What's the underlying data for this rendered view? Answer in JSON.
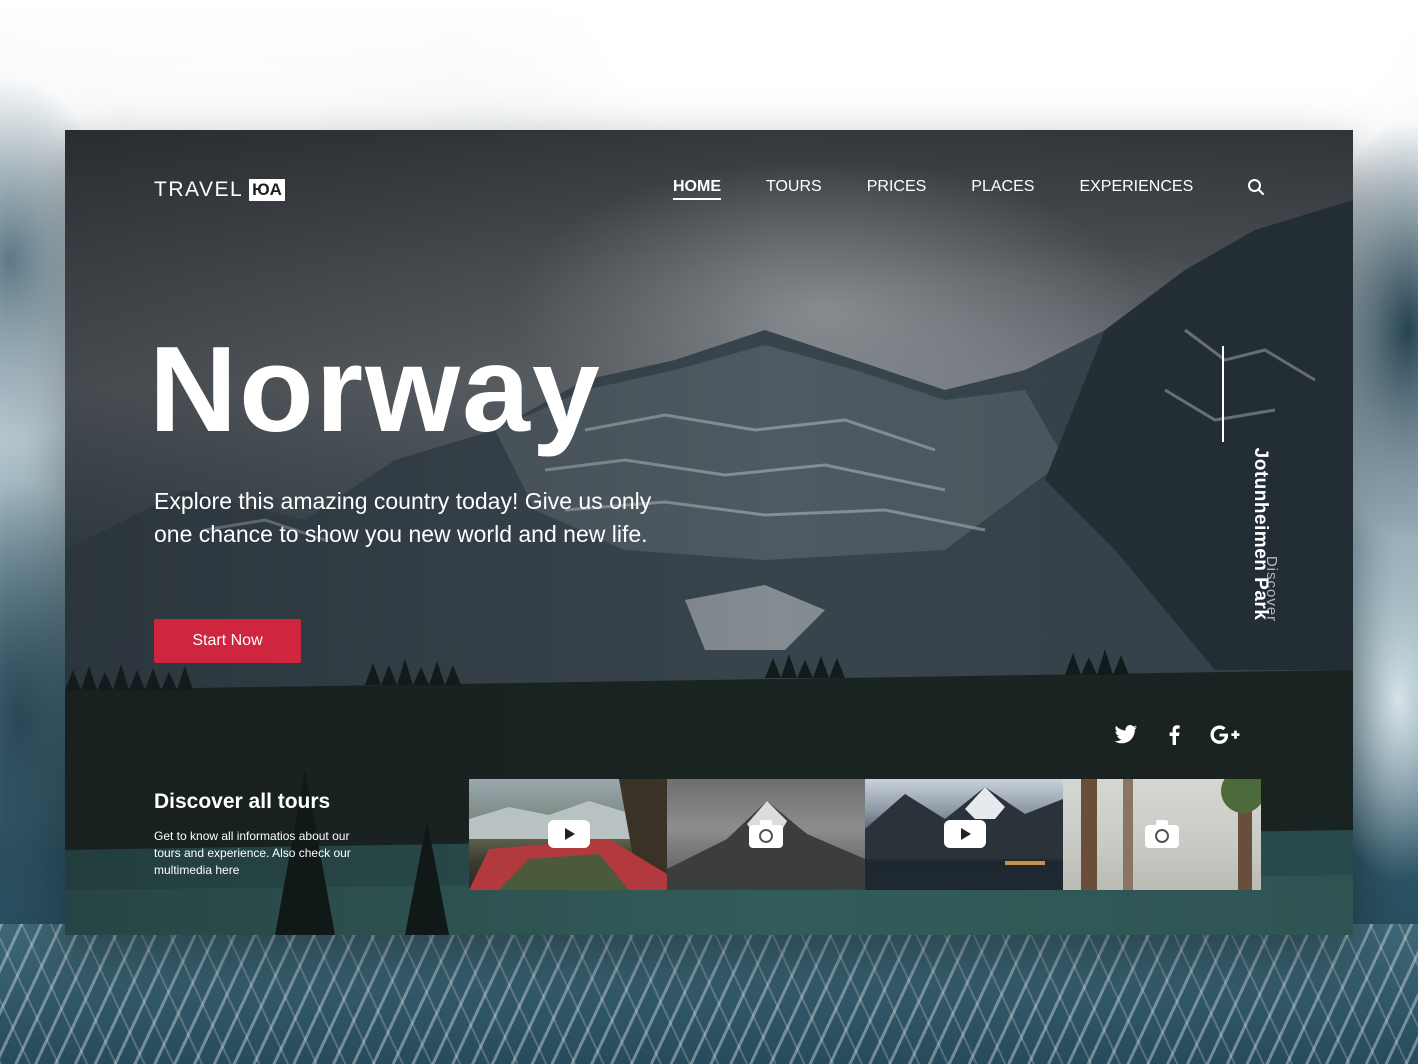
{
  "header": {
    "logo_text": "TRAVEL",
    "logo_badge": "ЮA",
    "nav": [
      {
        "label": "HOME",
        "active": true
      },
      {
        "label": "TOURS",
        "active": false
      },
      {
        "label": "PRICES",
        "active": false
      },
      {
        "label": "PLACES",
        "active": false
      },
      {
        "label": "EXPERIENCES",
        "active": false
      }
    ],
    "search_icon": "search-icon"
  },
  "hero": {
    "title": "Norway",
    "description": "Explore this amazing country today! Give us only one chance to show you new world and new life.",
    "cta_label": "Start Now",
    "cta_color": "#d0253f"
  },
  "side": {
    "park_name": "Jotunheimen Park",
    "discover_label": "Discover"
  },
  "social": [
    "twitter-icon",
    "facebook-icon",
    "google-plus-icon"
  ],
  "tours": {
    "title": "Discover all tours",
    "description": "Get to know all informatios about our tours and experience. Also check our multimedia here",
    "thumbnails": [
      {
        "media": "video",
        "icon": "play-icon"
      },
      {
        "media": "photo",
        "icon": "camera-icon"
      },
      {
        "media": "video",
        "icon": "play-icon"
      },
      {
        "media": "photo",
        "icon": "camera-icon"
      }
    ]
  }
}
